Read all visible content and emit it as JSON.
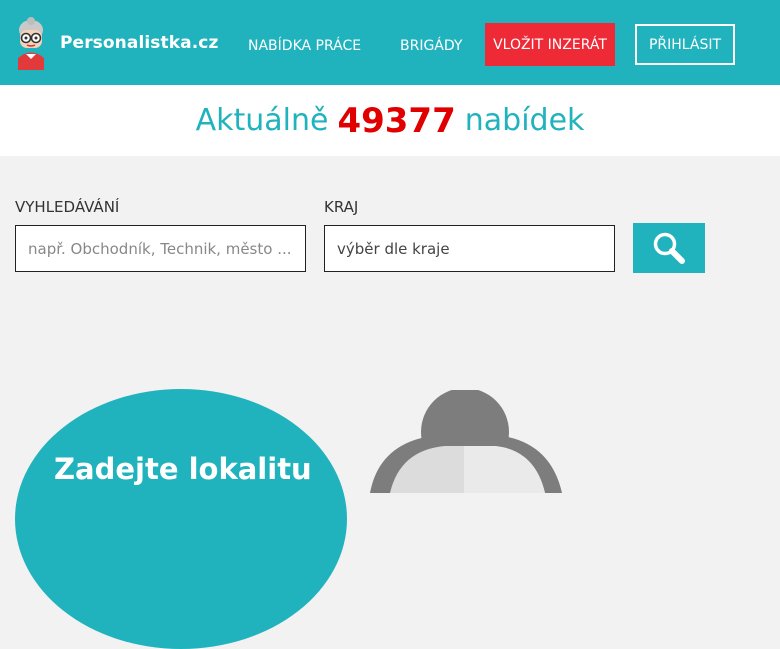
{
  "header": {
    "logo_text": "Personalistka.cz",
    "nav": {
      "jobs_label": "NABÍDKA PRÁCE",
      "brigades_label": "BRIGÁDY",
      "post_ad_label": "VLOŽIT INZERÁT",
      "login_label": "PŘIHLÁSIT"
    }
  },
  "counter": {
    "prefix": "Aktuálně",
    "count": "49377",
    "suffix": "nabídek"
  },
  "search": {
    "search_label": "VYHLEDÁVÁNÍ",
    "search_placeholder": "např. Obchodník, Technik, město ...",
    "region_label": "KRAJ",
    "region_value": "výběr dle kraje"
  },
  "promo": {
    "text": "Zadejte lokalitu"
  },
  "colors": {
    "accent": "#21b3bd",
    "cta_red": "#ee2a37",
    "counter_red": "#e00000",
    "page_bg": "#f2f2f2"
  }
}
